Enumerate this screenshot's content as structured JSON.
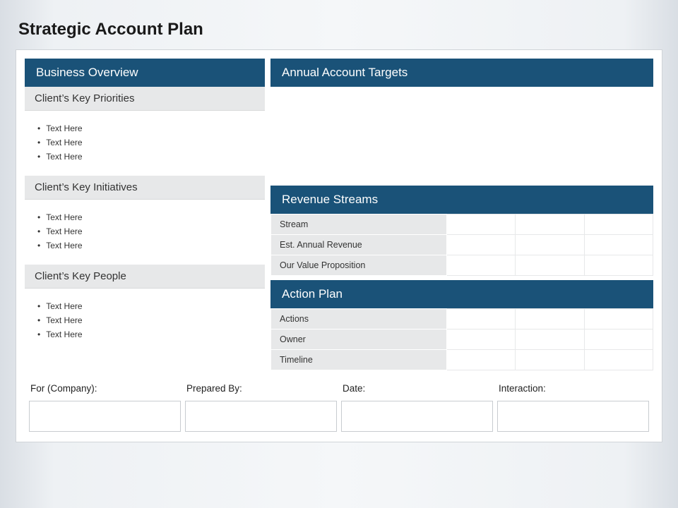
{
  "title": "Strategic Account Plan",
  "left": {
    "header": "Business Overview",
    "sections": [
      {
        "title": "Client’s Key Priorities",
        "items": [
          "Text Here",
          "Text Here",
          "Text Here"
        ]
      },
      {
        "title": "Client’s Key Initiatives",
        "items": [
          "Text Here",
          "Text Here",
          "Text Here"
        ]
      },
      {
        "title": "Client’s Key People",
        "items": [
          "Text Here",
          "Text Here",
          "Text Here"
        ]
      }
    ]
  },
  "right": {
    "targets_header": "Annual Account Targets",
    "revenue": {
      "header": "Revenue Streams",
      "rows": [
        "Stream",
        "Est. Annual Revenue",
        "Our Value Proposition"
      ]
    },
    "action": {
      "header": "Action Plan",
      "rows": [
        "Actions",
        "Owner",
        "Timeline"
      ]
    }
  },
  "footer": {
    "labels": [
      "For (Company):",
      "Prepared By:",
      "Date:",
      "Interaction:"
    ]
  }
}
